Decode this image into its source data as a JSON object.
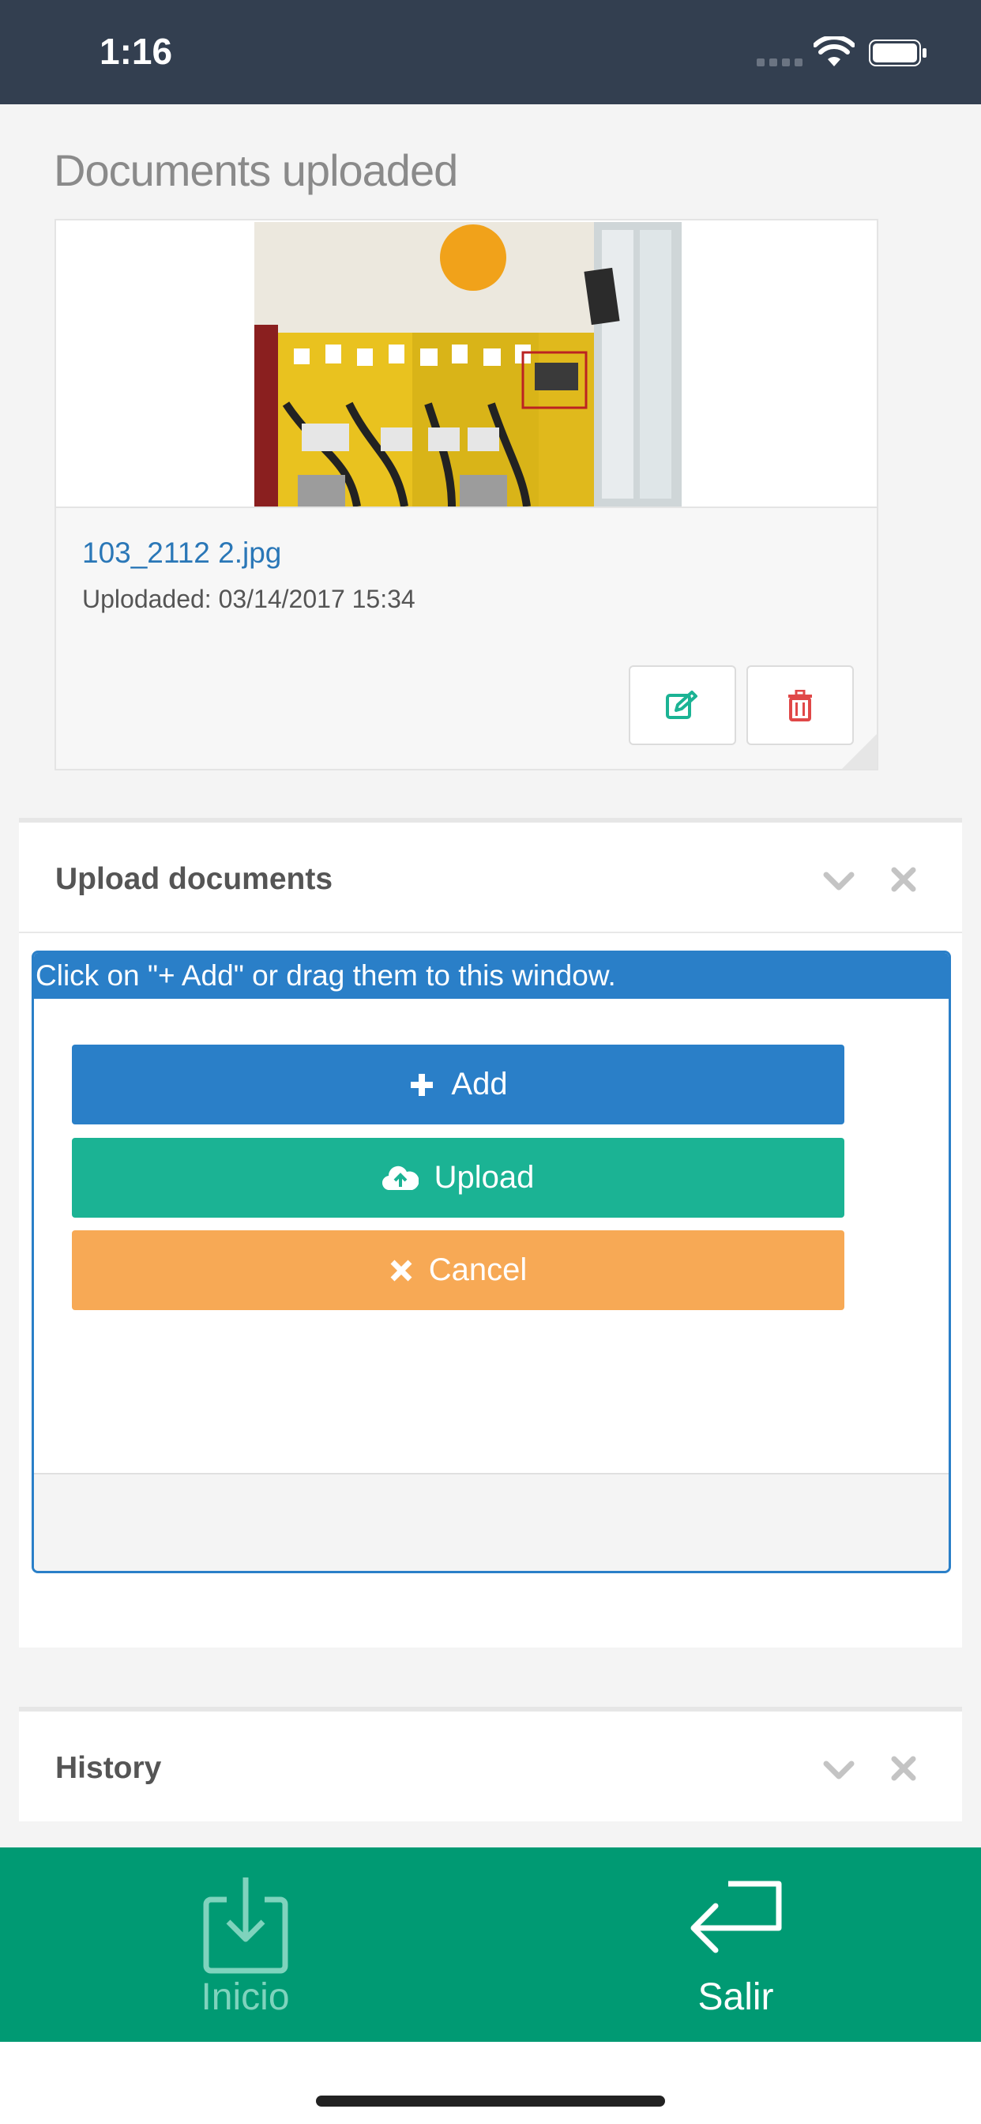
{
  "status_bar": {
    "time": "1:16"
  },
  "documents": {
    "title": "Documents uploaded",
    "items": [
      {
        "file_name": "103_2112 2.jpg",
        "uploaded": "Uplodaded: 03/14/2017 15:34"
      }
    ],
    "icons": {
      "edit": "edit-icon",
      "delete": "trash-icon"
    },
    "colors": {
      "edit": "#1bb394",
      "delete": "#e04848",
      "link": "#2a77b7"
    }
  },
  "upload_panel": {
    "title": "Upload documents",
    "hint": "Click on \"+ Add\" or drag them to this window.",
    "buttons": {
      "add": "Add",
      "upload": "Upload",
      "cancel": "Cancel"
    },
    "colors": {
      "add": "#2a7fc8",
      "upload": "#1bb394",
      "cancel": "#f7a955"
    }
  },
  "history_panel": {
    "title": "History"
  },
  "bottom_nav": {
    "items": [
      {
        "label": "Inicio",
        "icon": "download-tray-icon"
      },
      {
        "label": "Salir",
        "icon": "return-arrow-icon"
      }
    ],
    "color": "#009a73"
  }
}
